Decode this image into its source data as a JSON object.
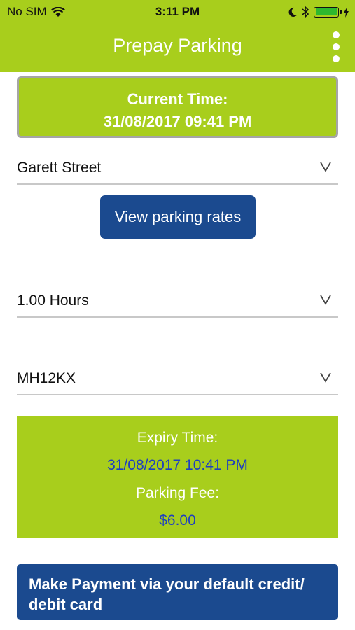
{
  "status_bar": {
    "carrier": "No SIM",
    "time": "3:11 PM",
    "icons": [
      "wifi-icon",
      "moon-icon",
      "bluetooth-icon",
      "battery-icon",
      "charging-bolt-icon"
    ],
    "battery_color": "#2eb82e",
    "battery_level": 1.0
  },
  "header": {
    "title": "Prepay Parking",
    "menu_icon": "kebab-menu-icon"
  },
  "current_time": {
    "label": "Current Time:",
    "value": "31/08/2017 09:41 PM"
  },
  "street_select": {
    "value": "Garett Street",
    "chevron": "V"
  },
  "rates_button": {
    "label": "View parking rates"
  },
  "duration_select": {
    "value": "1.00 Hours",
    "chevron": "V"
  },
  "plate_select": {
    "value": "MH12KX",
    "chevron": "V"
  },
  "expiry": {
    "expiry_label": "Expiry Time:",
    "expiry_value": "31/08/2017 10:41 PM",
    "fee_label": "Parking Fee:",
    "fee_value": "$6.00"
  },
  "payment_button": {
    "line1": "Make Payment via your default credit/",
    "line2": "debit card"
  },
  "colors": {
    "accent_green": "#a8ce1c",
    "button_blue": "#1b4a8f",
    "value_blue": "#1e3fbf"
  }
}
